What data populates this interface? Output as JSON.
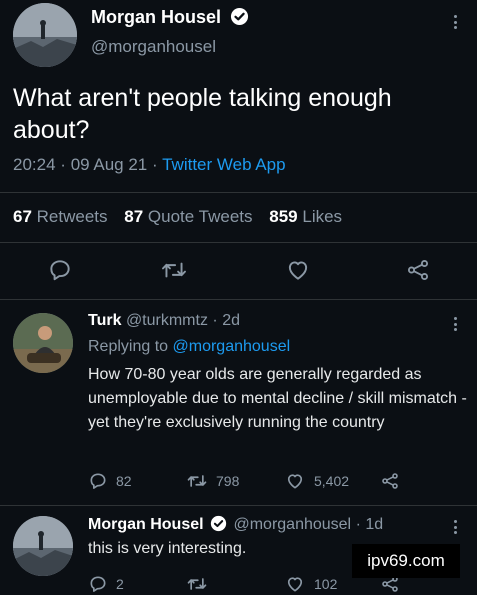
{
  "main_tweet": {
    "author_name": "Morgan Housel",
    "author_handle": "@morganhousel",
    "text": "What aren't people talking enough about?",
    "time": "20:24",
    "date": "09 Aug 21",
    "separator": "·",
    "app": "Twitter Web App",
    "stats": {
      "retweets_count": "67",
      "retweets_label": "Retweets",
      "quote_count": "87",
      "quote_label": "Quote Tweets",
      "likes_count": "859",
      "likes_label": "Likes"
    }
  },
  "reply_1": {
    "author_name": "Turk",
    "author_handle": "@turkmmtz",
    "age": "2d",
    "replying_prefix": "Replying to",
    "replying_to": "@morganhousel",
    "text": "How 70-80 year olds are generally regarded as unemployable due to mental decline / skill mismatch - yet they're exclusively running the country",
    "reply_count": "82",
    "retweet_count": "798",
    "like_count": "5,402"
  },
  "reply_2": {
    "author_name": "Morgan Housel",
    "author_handle": "@morganhousel",
    "age": "1d",
    "text": "this is very interesting.",
    "reply_count": "2",
    "retweet_count": "",
    "like_count": "102"
  },
  "watermark": "ipv69.com",
  "colors": {
    "background": "#0b0f14",
    "accent": "#1d9bf0",
    "secondary_text": "#8b98a5",
    "divider": "#2f3336"
  },
  "icons": [
    "verified-icon",
    "more-icon",
    "reply-icon",
    "retweet-icon",
    "like-icon",
    "share-icon"
  ]
}
